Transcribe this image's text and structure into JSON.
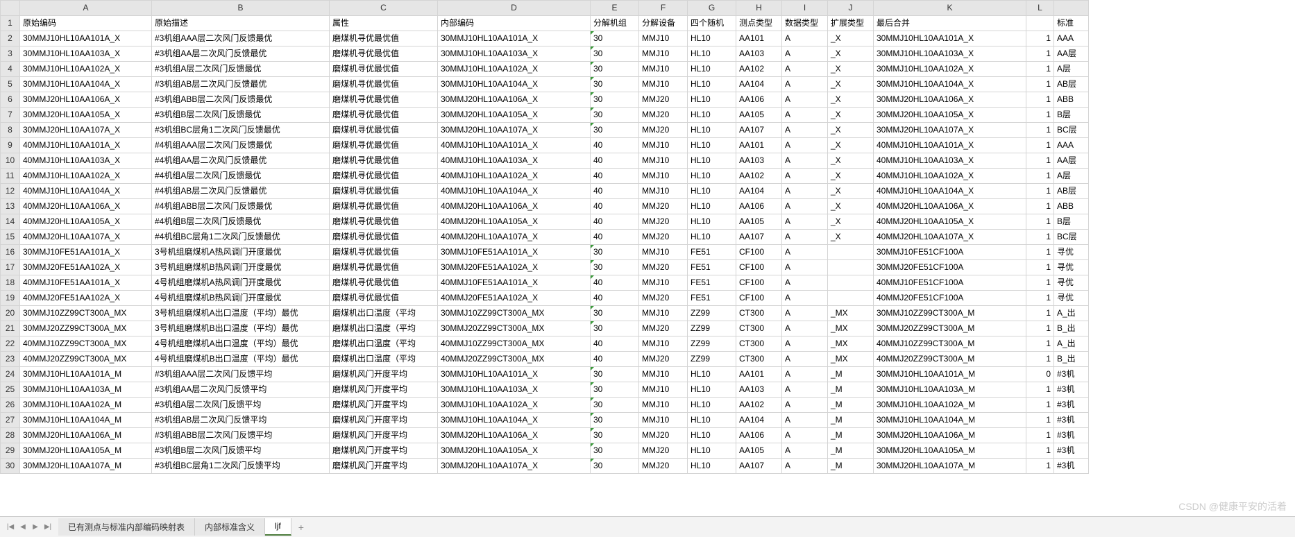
{
  "columns": [
    "A",
    "B",
    "C",
    "D",
    "E",
    "F",
    "G",
    "H",
    "I",
    "J",
    "K",
    "L",
    ""
  ],
  "headers": [
    "原始编码",
    "原始描述",
    "属性",
    "内部编码",
    "分解机组",
    "分解设备",
    "四个随机",
    "测点类型",
    "数据类型",
    "扩展类型",
    "最后合并",
    "",
    "标准"
  ],
  "rows": [
    {
      "n": 2,
      "A": "30MMJ10HL10AA101A_X",
      "B": "#3机组AAA层二次风门反馈最优",
      "C": "磨煤机寻优最优值",
      "D": "30MMJ10HL10AA101A_X",
      "E": "30",
      "F": "MMJ10",
      "G": "HL10",
      "H": "AA101",
      "I": "A",
      "J": "_X",
      "K": "30MMJ10HL10AA101A_X",
      "L": "1",
      "M": "AAA"
    },
    {
      "n": 3,
      "A": "30MMJ10HL10AA103A_X",
      "B": "#3机组AA层二次风门反馈最优",
      "C": "磨煤机寻优最优值",
      "D": "30MMJ10HL10AA103A_X",
      "E": "30",
      "F": "MMJ10",
      "G": "HL10",
      "H": "AA103",
      "I": "A",
      "J": "_X",
      "K": "30MMJ10HL10AA103A_X",
      "L": "1",
      "M": "AA层"
    },
    {
      "n": 4,
      "A": "30MMJ10HL10AA102A_X",
      "B": "#3机组A层二次风门反馈最优",
      "C": "磨煤机寻优最优值",
      "D": "30MMJ10HL10AA102A_X",
      "E": "30",
      "F": "MMJ10",
      "G": "HL10",
      "H": "AA102",
      "I": "A",
      "J": "_X",
      "K": "30MMJ10HL10AA102A_X",
      "L": "1",
      "M": "A层"
    },
    {
      "n": 5,
      "A": "30MMJ10HL10AA104A_X",
      "B": "#3机组AB层二次风门反馈最优",
      "C": "磨煤机寻优最优值",
      "D": "30MMJ10HL10AA104A_X",
      "E": "30",
      "F": "MMJ10",
      "G": "HL10",
      "H": "AA104",
      "I": "A",
      "J": "_X",
      "K": "30MMJ10HL10AA104A_X",
      "L": "1",
      "M": "AB层"
    },
    {
      "n": 6,
      "A": "30MMJ20HL10AA106A_X",
      "B": "#3机组ABB层二次风门反馈最优",
      "C": "磨煤机寻优最优值",
      "D": "30MMJ20HL10AA106A_X",
      "E": "30",
      "F": "MMJ20",
      "G": "HL10",
      "H": "AA106",
      "I": "A",
      "J": "_X",
      "K": "30MMJ20HL10AA106A_X",
      "L": "1",
      "M": "ABB"
    },
    {
      "n": 7,
      "A": "30MMJ20HL10AA105A_X",
      "B": "#3机组B层二次风门反馈最优",
      "C": "磨煤机寻优最优值",
      "D": "30MMJ20HL10AA105A_X",
      "E": "30",
      "F": "MMJ20",
      "G": "HL10",
      "H": "AA105",
      "I": "A",
      "J": "_X",
      "K": "30MMJ20HL10AA105A_X",
      "L": "1",
      "M": "B层"
    },
    {
      "n": 8,
      "A": "30MMJ20HL10AA107A_X",
      "B": "#3机组BC层角1二次风门反馈最优",
      "C": "磨煤机寻优最优值",
      "D": "30MMJ20HL10AA107A_X",
      "E": "30",
      "F": "MMJ20",
      "G": "HL10",
      "H": "AA107",
      "I": "A",
      "J": "_X",
      "K": "30MMJ20HL10AA107A_X",
      "L": "1",
      "M": "BC层"
    },
    {
      "n": 9,
      "A": "40MMJ10HL10AA101A_X",
      "B": "#4机组AAA层二次风门反馈最优",
      "C": "磨煤机寻优最优值",
      "D": "40MMJ10HL10AA101A_X",
      "E": "40",
      "F": "MMJ10",
      "G": "HL10",
      "H": "AA101",
      "I": "A",
      "J": "_X",
      "K": "40MMJ10HL10AA101A_X",
      "L": "1",
      "M": "AAA"
    },
    {
      "n": 10,
      "A": "40MMJ10HL10AA103A_X",
      "B": "#4机组AA层二次风门反馈最优",
      "C": "磨煤机寻优最优值",
      "D": "40MMJ10HL10AA103A_X",
      "E": "40",
      "F": "MMJ10",
      "G": "HL10",
      "H": "AA103",
      "I": "A",
      "J": "_X",
      "K": "40MMJ10HL10AA103A_X",
      "L": "1",
      "M": "AA层"
    },
    {
      "n": 11,
      "A": "40MMJ10HL10AA102A_X",
      "B": "#4机组A层二次风门反馈最优",
      "C": "磨煤机寻优最优值",
      "D": "40MMJ10HL10AA102A_X",
      "E": "40",
      "F": "MMJ10",
      "G": "HL10",
      "H": "AA102",
      "I": "A",
      "J": "_X",
      "K": "40MMJ10HL10AA102A_X",
      "L": "1",
      "M": "A层"
    },
    {
      "n": 12,
      "A": "40MMJ10HL10AA104A_X",
      "B": "#4机组AB层二次风门反馈最优",
      "C": "磨煤机寻优最优值",
      "D": "40MMJ10HL10AA104A_X",
      "E": "40",
      "F": "MMJ10",
      "G": "HL10",
      "H": "AA104",
      "I": "A",
      "J": "_X",
      "K": "40MMJ10HL10AA104A_X",
      "L": "1",
      "M": "AB层"
    },
    {
      "n": 13,
      "A": "40MMJ20HL10AA106A_X",
      "B": "#4机组ABB层二次风门反馈最优",
      "C": "磨煤机寻优最优值",
      "D": "40MMJ20HL10AA106A_X",
      "E": "40",
      "F": "MMJ20",
      "G": "HL10",
      "H": "AA106",
      "I": "A",
      "J": "_X",
      "K": "40MMJ20HL10AA106A_X",
      "L": "1",
      "M": "ABB"
    },
    {
      "n": 14,
      "A": "40MMJ20HL10AA105A_X",
      "B": "#4机组B层二次风门反馈最优",
      "C": "磨煤机寻优最优值",
      "D": "40MMJ20HL10AA105A_X",
      "E": "40",
      "F": "MMJ20",
      "G": "HL10",
      "H": "AA105",
      "I": "A",
      "J": "_X",
      "K": "40MMJ20HL10AA105A_X",
      "L": "1",
      "M": "B层"
    },
    {
      "n": 15,
      "A": "40MMJ20HL10AA107A_X",
      "B": "#4机组BC层角1二次风门反馈最优",
      "C": "磨煤机寻优最优值",
      "D": "40MMJ20HL10AA107A_X",
      "E": "40",
      "F": "MMJ20",
      "G": "HL10",
      "H": "AA107",
      "I": "A",
      "J": "_X",
      "K": "40MMJ20HL10AA107A_X",
      "L": "1",
      "M": "BC层"
    },
    {
      "n": 16,
      "A": "30MMJ10FE51AA101A_X",
      "B": "3号机组磨煤机A热风调门开度最优",
      "C": "磨煤机寻优最优值",
      "D": "30MMJ10FE51AA101A_X",
      "E": "30",
      "F": "MMJ10",
      "G": "FE51",
      "H": "CF100",
      "I": "A",
      "J": "",
      "K": "30MMJ10FE51CF100A",
      "L": "1",
      "M": "寻优"
    },
    {
      "n": 17,
      "A": "30MMJ20FE51AA102A_X",
      "B": "3号机组磨煤机B热风调门开度最优",
      "C": "磨煤机寻优最优值",
      "D": "30MMJ20FE51AA102A_X",
      "E": "30",
      "F": "MMJ20",
      "G": "FE51",
      "H": "CF100",
      "I": "A",
      "J": "",
      "K": "30MMJ20FE51CF100A",
      "L": "1",
      "M": "寻优"
    },
    {
      "n": 18,
      "A": "40MMJ10FE51AA101A_X",
      "B": "4号机组磨煤机A热风调门开度最优",
      "C": "磨煤机寻优最优值",
      "D": "40MMJ10FE51AA101A_X",
      "E": "40",
      "F": "MMJ10",
      "G": "FE51",
      "H": "CF100",
      "I": "A",
      "J": "",
      "K": "40MMJ10FE51CF100A",
      "L": "1",
      "M": "寻优"
    },
    {
      "n": 19,
      "A": "40MMJ20FE51AA102A_X",
      "B": "4号机组磨煤机B热风调门开度最优",
      "C": "磨煤机寻优最优值",
      "D": "40MMJ20FE51AA102A_X",
      "E": "40",
      "F": "MMJ20",
      "G": "FE51",
      "H": "CF100",
      "I": "A",
      "J": "",
      "K": "40MMJ20FE51CF100A",
      "L": "1",
      "M": "寻优"
    },
    {
      "n": 20,
      "A": "30MMJ10ZZ99CT300A_MX",
      "B": "3号机组磨煤机A出口温度（平均）最优",
      "C": "磨煤机出口温度（平均",
      "D": "30MMJ10ZZ99CT300A_MX",
      "E": "30",
      "F": "MMJ10",
      "G": "ZZ99",
      "H": "CT300",
      "I": "A",
      "J": "_MX",
      "K": "30MMJ10ZZ99CT300A_M",
      "L": "1",
      "M": "A_出"
    },
    {
      "n": 21,
      "A": "30MMJ20ZZ99CT300A_MX",
      "B": "3号机组磨煤机B出口温度（平均）最优",
      "C": "磨煤机出口温度（平均",
      "D": "30MMJ20ZZ99CT300A_MX",
      "E": "30",
      "F": "MMJ20",
      "G": "ZZ99",
      "H": "CT300",
      "I": "A",
      "J": "_MX",
      "K": "30MMJ20ZZ99CT300A_M",
      "L": "1",
      "M": "B_出"
    },
    {
      "n": 22,
      "A": "40MMJ10ZZ99CT300A_MX",
      "B": "4号机组磨煤机A出口温度（平均）最优",
      "C": "磨煤机出口温度（平均",
      "D": "40MMJ10ZZ99CT300A_MX",
      "E": "40",
      "F": "MMJ10",
      "G": "ZZ99",
      "H": "CT300",
      "I": "A",
      "J": "_MX",
      "K": "40MMJ10ZZ99CT300A_M",
      "L": "1",
      "M": "A_出"
    },
    {
      "n": 23,
      "A": "40MMJ20ZZ99CT300A_MX",
      "B": "4号机组磨煤机B出口温度（平均）最优",
      "C": "磨煤机出口温度（平均",
      "D": "40MMJ20ZZ99CT300A_MX",
      "E": "40",
      "F": "MMJ20",
      "G": "ZZ99",
      "H": "CT300",
      "I": "A",
      "J": "_MX",
      "K": "40MMJ20ZZ99CT300A_M",
      "L": "1",
      "M": "B_出"
    },
    {
      "n": 24,
      "A": "30MMJ10HL10AA101A_M",
      "B": "#3机组AAA层二次风门反馈平均",
      "C": "磨煤机风门开度平均",
      "D": "30MMJ10HL10AA101A_X",
      "E": "30",
      "F": "MMJ10",
      "G": "HL10",
      "H": "AA101",
      "I": "A",
      "J": "_M",
      "K": "30MMJ10HL10AA101A_M",
      "L": "0",
      "M": "#3机"
    },
    {
      "n": 25,
      "A": "30MMJ10HL10AA103A_M",
      "B": "#3机组AA层二次风门反馈平均",
      "C": "磨煤机风门开度平均",
      "D": "30MMJ10HL10AA103A_X",
      "E": "30",
      "F": "MMJ10",
      "G": "HL10",
      "H": "AA103",
      "I": "A",
      "J": "_M",
      "K": "30MMJ10HL10AA103A_M",
      "L": "1",
      "M": "#3机"
    },
    {
      "n": 26,
      "A": "30MMJ10HL10AA102A_M",
      "B": "#3机组A层二次风门反馈平均",
      "C": "磨煤机风门开度平均",
      "D": "30MMJ10HL10AA102A_X",
      "E": "30",
      "F": "MMJ10",
      "G": "HL10",
      "H": "AA102",
      "I": "A",
      "J": "_M",
      "K": "30MMJ10HL10AA102A_M",
      "L": "1",
      "M": "#3机"
    },
    {
      "n": 27,
      "A": "30MMJ10HL10AA104A_M",
      "B": "#3机组AB层二次风门反馈平均",
      "C": "磨煤机风门开度平均",
      "D": "30MMJ10HL10AA104A_X",
      "E": "30",
      "F": "MMJ10",
      "G": "HL10",
      "H": "AA104",
      "I": "A",
      "J": "_M",
      "K": "30MMJ10HL10AA104A_M",
      "L": "1",
      "M": "#3机"
    },
    {
      "n": 28,
      "A": "30MMJ20HL10AA106A_M",
      "B": "#3机组ABB层二次风门反馈平均",
      "C": "磨煤机风门开度平均",
      "D": "30MMJ20HL10AA106A_X",
      "E": "30",
      "F": "MMJ20",
      "G": "HL10",
      "H": "AA106",
      "I": "A",
      "J": "_M",
      "K": "30MMJ20HL10AA106A_M",
      "L": "1",
      "M": "#3机"
    },
    {
      "n": 29,
      "A": "30MMJ20HL10AA105A_M",
      "B": "#3机组B层二次风门反馈平均",
      "C": "磨煤机风门开度平均",
      "D": "30MMJ20HL10AA105A_X",
      "E": "30",
      "F": "MMJ20",
      "G": "HL10",
      "H": "AA105",
      "I": "A",
      "J": "_M",
      "K": "30MMJ20HL10AA105A_M",
      "L": "1",
      "M": "#3机"
    },
    {
      "n": 30,
      "A": "30MMJ20HL10AA107A_M",
      "B": "#3机组BC层角1二次风门反馈平均",
      "C": "磨煤机风门开度平均",
      "D": "30MMJ20HL10AA107A_X",
      "E": "30",
      "F": "MMJ20",
      "G": "HL10",
      "H": "AA107",
      "I": "A",
      "J": "_M",
      "K": "30MMJ20HL10AA107A_M",
      "L": "1",
      "M": "#3机"
    }
  ],
  "markCols": [
    "E"
  ],
  "markRowsSkip": [
    9,
    10,
    11,
    12,
    13,
    14,
    15,
    19,
    22,
    23
  ],
  "tabs": [
    {
      "label": "已有测点与标准内部编码映射表",
      "active": false
    },
    {
      "label": "内部标准含义",
      "active": false
    },
    {
      "label": "ljf",
      "active": true
    }
  ],
  "nav": {
    "first": "|◀",
    "prev": "◀",
    "next": "▶",
    "last": "▶|",
    "add": "+"
  },
  "watermark": "CSDN @健康平安的活着"
}
